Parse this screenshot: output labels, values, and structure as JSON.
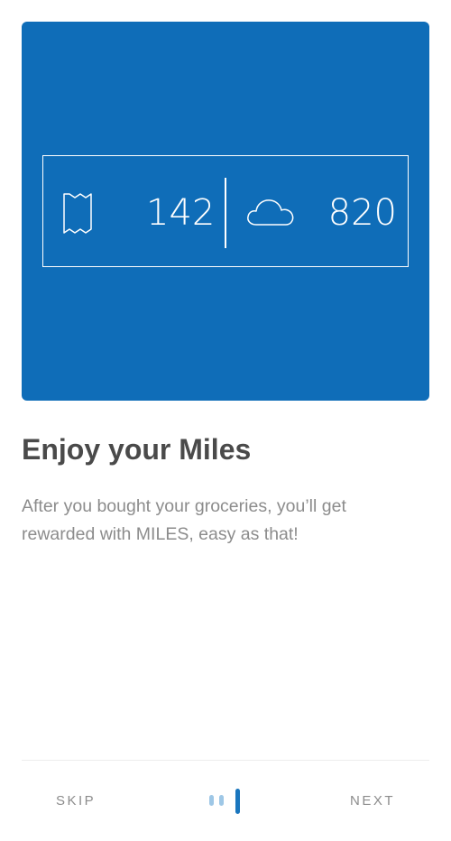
{
  "hero": {
    "receipts_count": "142",
    "miles_count": "820",
    "receipt_icon": "receipt-icon",
    "cloud_icon": "cloud-icon",
    "background_color": "#0f6db8"
  },
  "onboarding": {
    "title": "Enjoy your Miles",
    "description": "After you bought your groceries, you’ll get rewarded with MILES, easy as that!"
  },
  "footer": {
    "skip_label": "SKIP",
    "next_label": "NEXT",
    "page_indicator": {
      "total_pages": 3,
      "current_page": 3,
      "active_color": "#1a76be",
      "inactive_color": "#9ec7e6"
    }
  }
}
